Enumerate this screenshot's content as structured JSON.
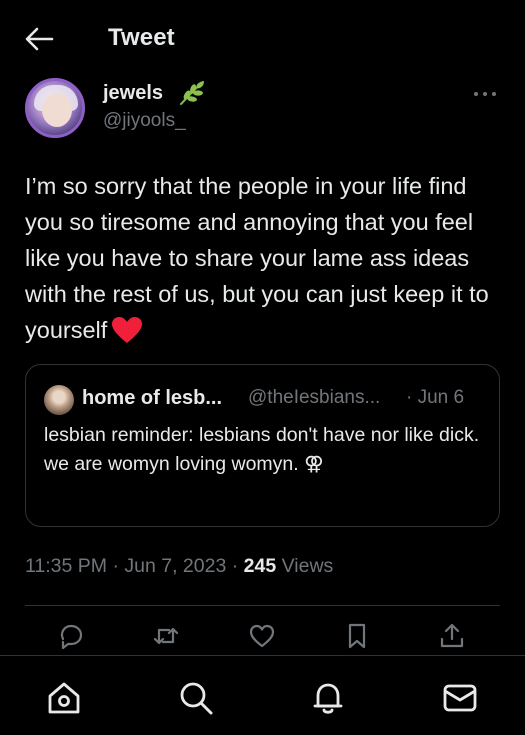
{
  "header": {
    "title": "Tweet",
    "back_icon": "arrow-left-icon"
  },
  "author": {
    "display_name": "jewels",
    "name_emoji": "herb-icon",
    "handle": "@jiyools_"
  },
  "tweet": {
    "text": "I’m so sorry that the people in your life find you so tiresome and annoying that you feel like you have to share your lame ass ideas with the rest of us, but you can just keep it to yourself",
    "trailing_emoji": "red-heart-icon"
  },
  "quoted_tweet": {
    "name": "home of lesb...",
    "handle": "@theIesbians...",
    "date": "· Jun 6",
    "text_line1": "lesbian reminder: lesbians don't have nor like dick.",
    "text_line2": "we are womyn loving womyn. ⚢"
  },
  "meta": {
    "time": "11:35 PM",
    "date": "Jun 7, 2023",
    "separator": "·",
    "views_count": "245",
    "views_label": "Views"
  },
  "actions": [
    "reply-icon",
    "retweet-icon",
    "like-icon",
    "bookmark-icon",
    "share-icon"
  ],
  "bottom_nav": [
    "home-icon",
    "search-icon",
    "notifications-icon",
    "messages-icon"
  ],
  "colors": {
    "background": "#000000",
    "text_primary": "#e7e9ea",
    "text_secondary": "#71767b",
    "border": "#2f3336",
    "heart": "#f91880"
  }
}
